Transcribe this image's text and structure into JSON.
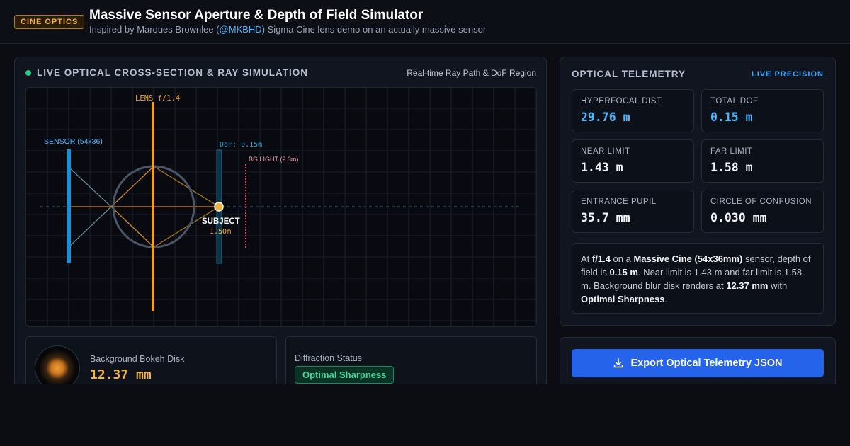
{
  "header": {
    "brand": "CINE OPTICS",
    "title": "Massive Sensor Aperture & Depth of Field Simulator",
    "subtitle_prefix": "Inspired by Marques Brownlee (",
    "subtitle_handle": "@MKBHD",
    "subtitle_suffix": ") Sigma Cine lens demo on an actually massive sensor"
  },
  "simulation": {
    "title": "LIVE OPTICAL CROSS-SECTION & RAY SIMULATION",
    "subtitle": "Real-time Ray Path & DoF Region",
    "lens_label": "LENS f/1.4",
    "sensor_label": "SENSOR (54x36)",
    "dof_label": "DoF: 0.15m",
    "bg_light_label": "BG LIGHT (2.3m)",
    "subject_label": "SUBJECT",
    "subject_distance": "1.50m",
    "colors": {
      "lens": "#f0a020",
      "sensor": "#1a8fd6",
      "dof": "#1c6f8f",
      "bg_light": "#e03a5a",
      "subject": "#f3b23a"
    }
  },
  "bokeh": {
    "label": "Background Bokeh Disk",
    "value": "12.37 mm"
  },
  "diffraction": {
    "label": "Diffraction Status",
    "status": "Optimal Sharpness"
  },
  "telemetry": {
    "title": "OPTICAL TELEMETRY",
    "badge": "LIVE PRECISION",
    "metrics": [
      {
        "label": "HYPERFOCAL DIST.",
        "value": "29.76 m"
      },
      {
        "label": "TOTAL DOF",
        "value": "0.15 m"
      },
      {
        "label": "NEAR LIMIT",
        "value": "1.43 m"
      },
      {
        "label": "FAR LIMIT",
        "value": "1.58 m"
      },
      {
        "label": "ENTRANCE PUPIL",
        "value": "35.7 mm"
      },
      {
        "label": "CIRCLE OF CONFUSION",
        "value": "0.030 mm"
      }
    ],
    "summary": {
      "p1": "At ",
      "aperture": "f/1.4",
      "p2": " on a ",
      "sensor": "Massive Cine (54x36mm)",
      "p3": " sensor, depth of field is ",
      "dof": "0.15 m",
      "p4": ". Near limit is 1.43 m and far limit is 1.58 m. Background blur disk renders at ",
      "blur": "12.37 mm",
      "p5": " with ",
      "quality": "Optimal Sharpness",
      "p6": "."
    }
  },
  "export": {
    "label": "Export Optical Telemetry JSON"
  }
}
